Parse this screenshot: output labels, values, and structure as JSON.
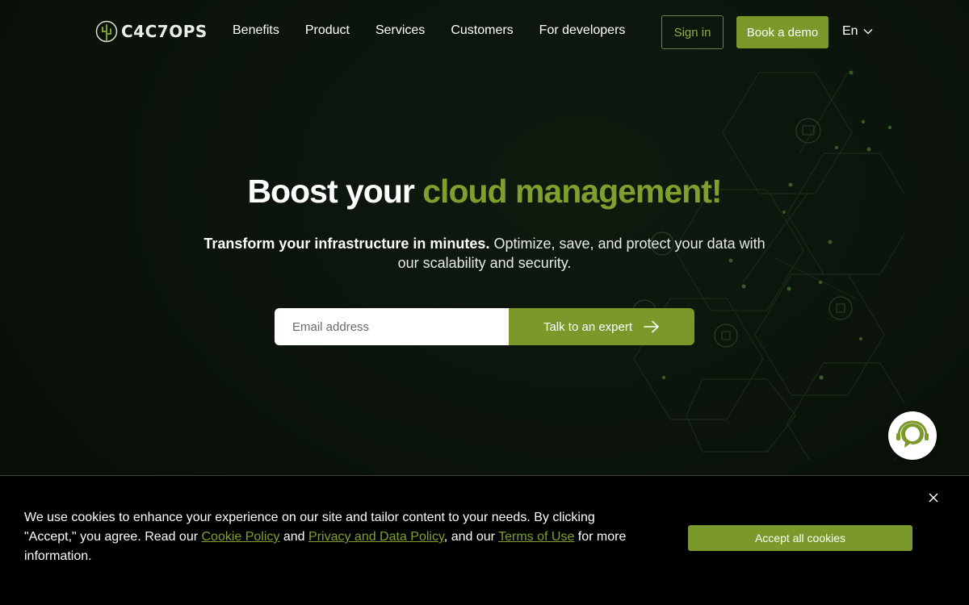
{
  "header": {
    "logo_text": "C4C7OPS",
    "nav": [
      "Benefits",
      "Product",
      "Services",
      "Customers",
      "For developers"
    ],
    "signin_label": "Sign in",
    "demo_label": "Book a demo",
    "language": "En"
  },
  "hero": {
    "title_plain": "Boost your ",
    "title_accent": "cloud management!",
    "subtitle_bold": "Transform your infrastructure in minutes.",
    "subtitle_rest": " Optimize, save, and protect your data with our scalability and security.",
    "email_placeholder": "Email address",
    "cta_label": "Talk to an expert"
  },
  "cookie": {
    "text_1": "We use cookies to enhance your experience on our site and tailor content to your needs. By clicking \"Accept,\" you agree. Read our ",
    "link_cookie": "Cookie Policy",
    "text_2": " and ",
    "link_privacy": "Privacy and Data Policy",
    "text_3": ", and our ",
    "link_terms": "Terms of Use",
    "text_4": " for more information.",
    "accept_label": "Accept all cookies"
  },
  "colors": {
    "accent": "#7a992a",
    "accent_text": "#7fa02e",
    "background": "#0b130b"
  },
  "icons": {
    "logo": "cactus-icon",
    "language": "chevron-down-icon",
    "cta": "arrow-right-icon",
    "chat": "chat-support-icon",
    "close": "close-icon"
  }
}
